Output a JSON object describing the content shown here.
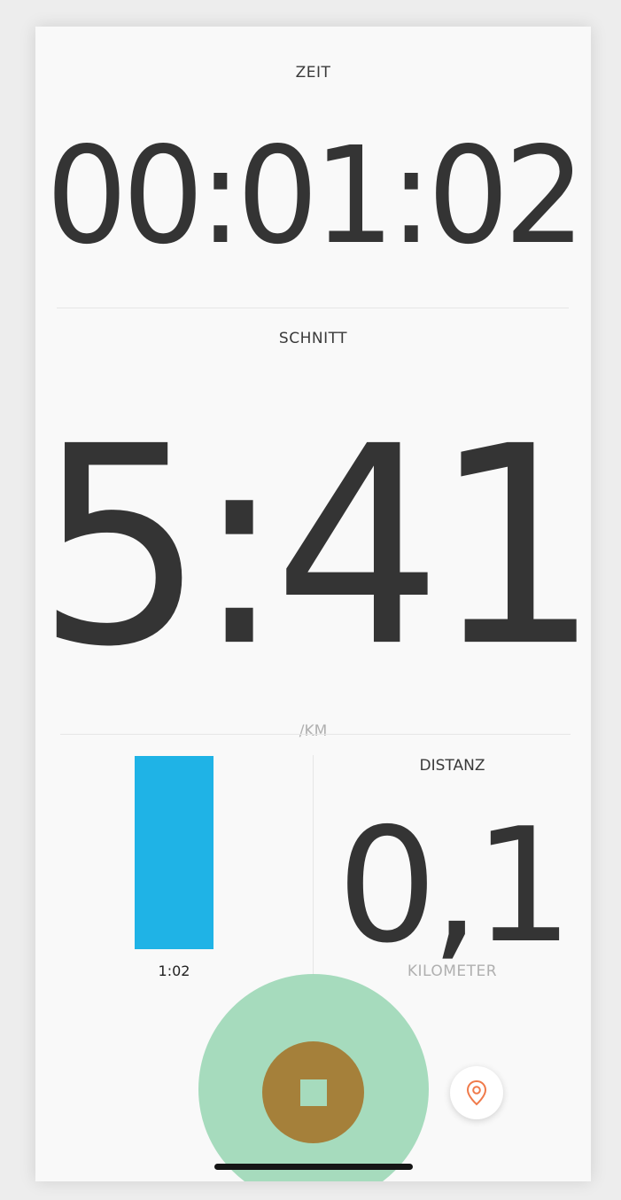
{
  "time": {
    "label": "ZEIT",
    "value": "00:01:02"
  },
  "pace": {
    "label": "SCHNITT",
    "value": "5:41",
    "unit": "/KM"
  },
  "split": {
    "label": "1:02",
    "bar_color": "#1fb3e6"
  },
  "distance": {
    "label": "DISTANZ",
    "value": "0,1",
    "unit": "KILOMETER"
  },
  "controls": {
    "stop_icon": "stop-icon",
    "map_icon": "location-pin-icon",
    "stop_color": "#a5803a",
    "halo_color": "#a6dbbd",
    "accent_color": "#f07a4a"
  }
}
